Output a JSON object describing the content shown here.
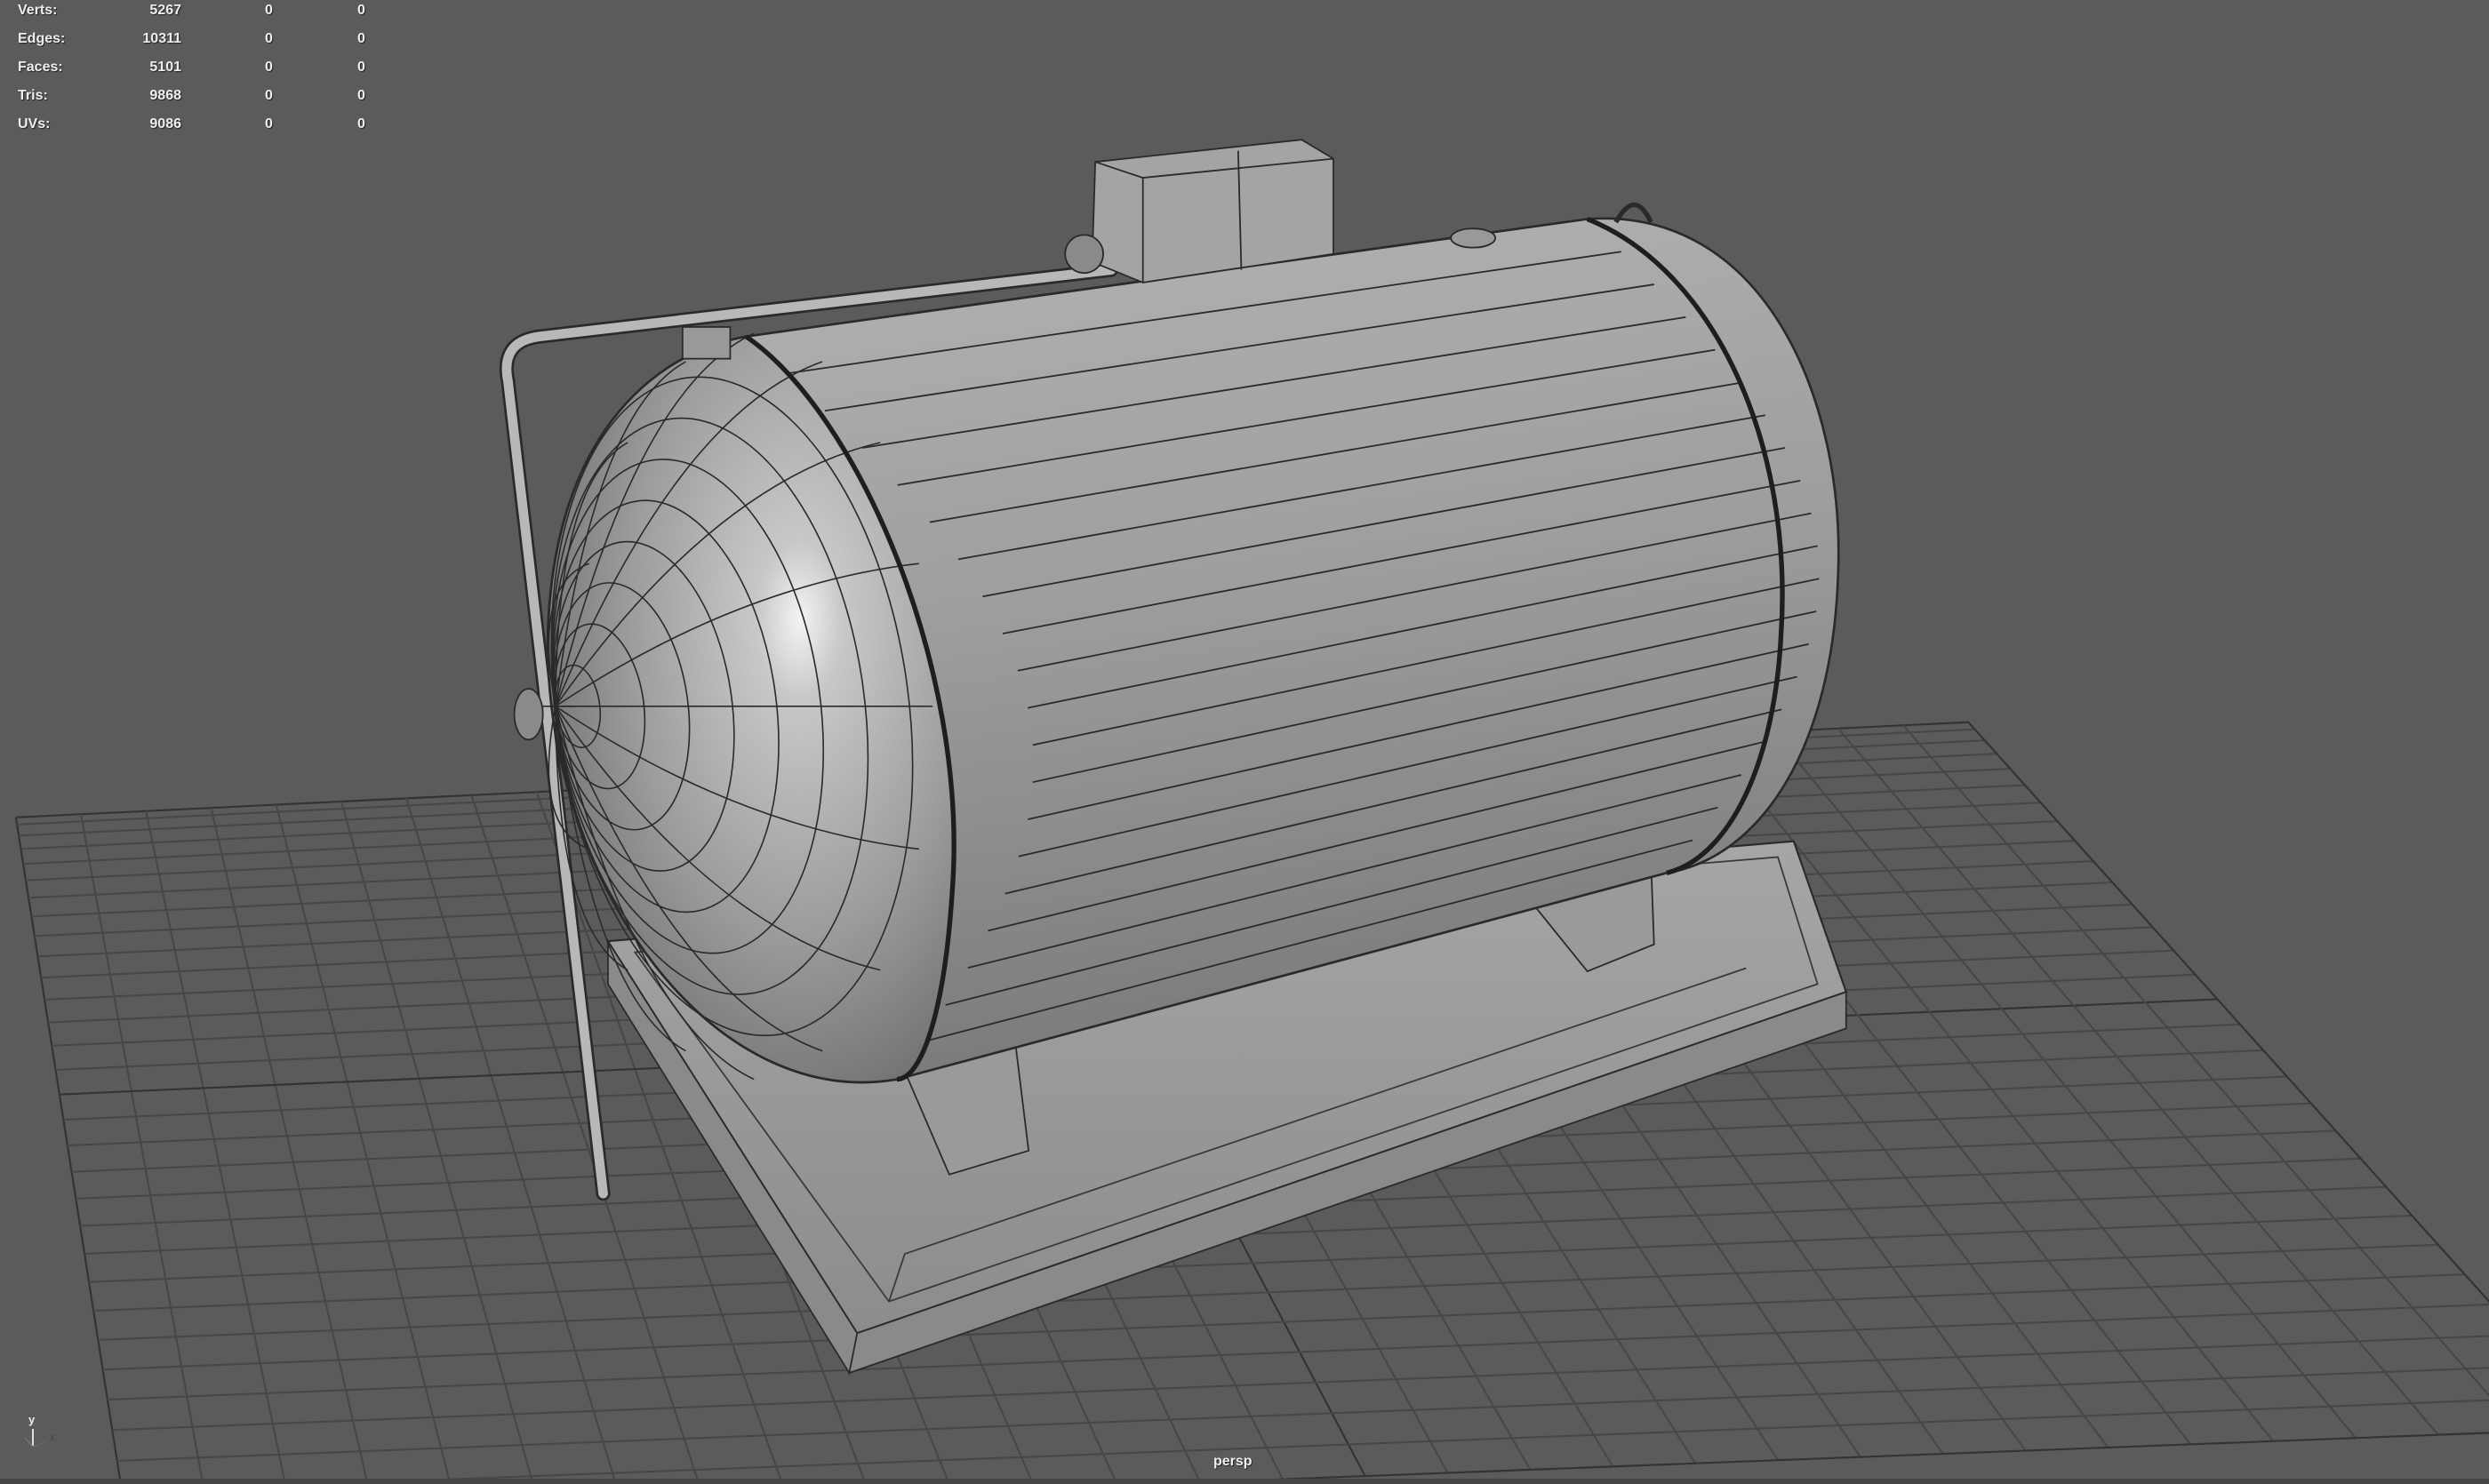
{
  "hud": {
    "rows": [
      {
        "label": "Verts:",
        "v1": "5267",
        "v2": "0",
        "v3": "0"
      },
      {
        "label": "Edges:",
        "v1": "10311",
        "v2": "0",
        "v3": "0"
      },
      {
        "label": "Faces:",
        "v1": "5101",
        "v2": "0",
        "v3": "0"
      },
      {
        "label": "Tris:",
        "v1": "9868",
        "v2": "0",
        "v3": "0"
      },
      {
        "label": "UVs:",
        "v1": "9086",
        "v2": "0",
        "v3": "0"
      }
    ]
  },
  "camera_label": "persp",
  "axis": {
    "y": "y",
    "x": "x"
  },
  "colors": {
    "background": "#5b5b5b",
    "grid": "#4a4a4a",
    "model": "#a8a8a8",
    "wire": "#2a2a2a"
  }
}
